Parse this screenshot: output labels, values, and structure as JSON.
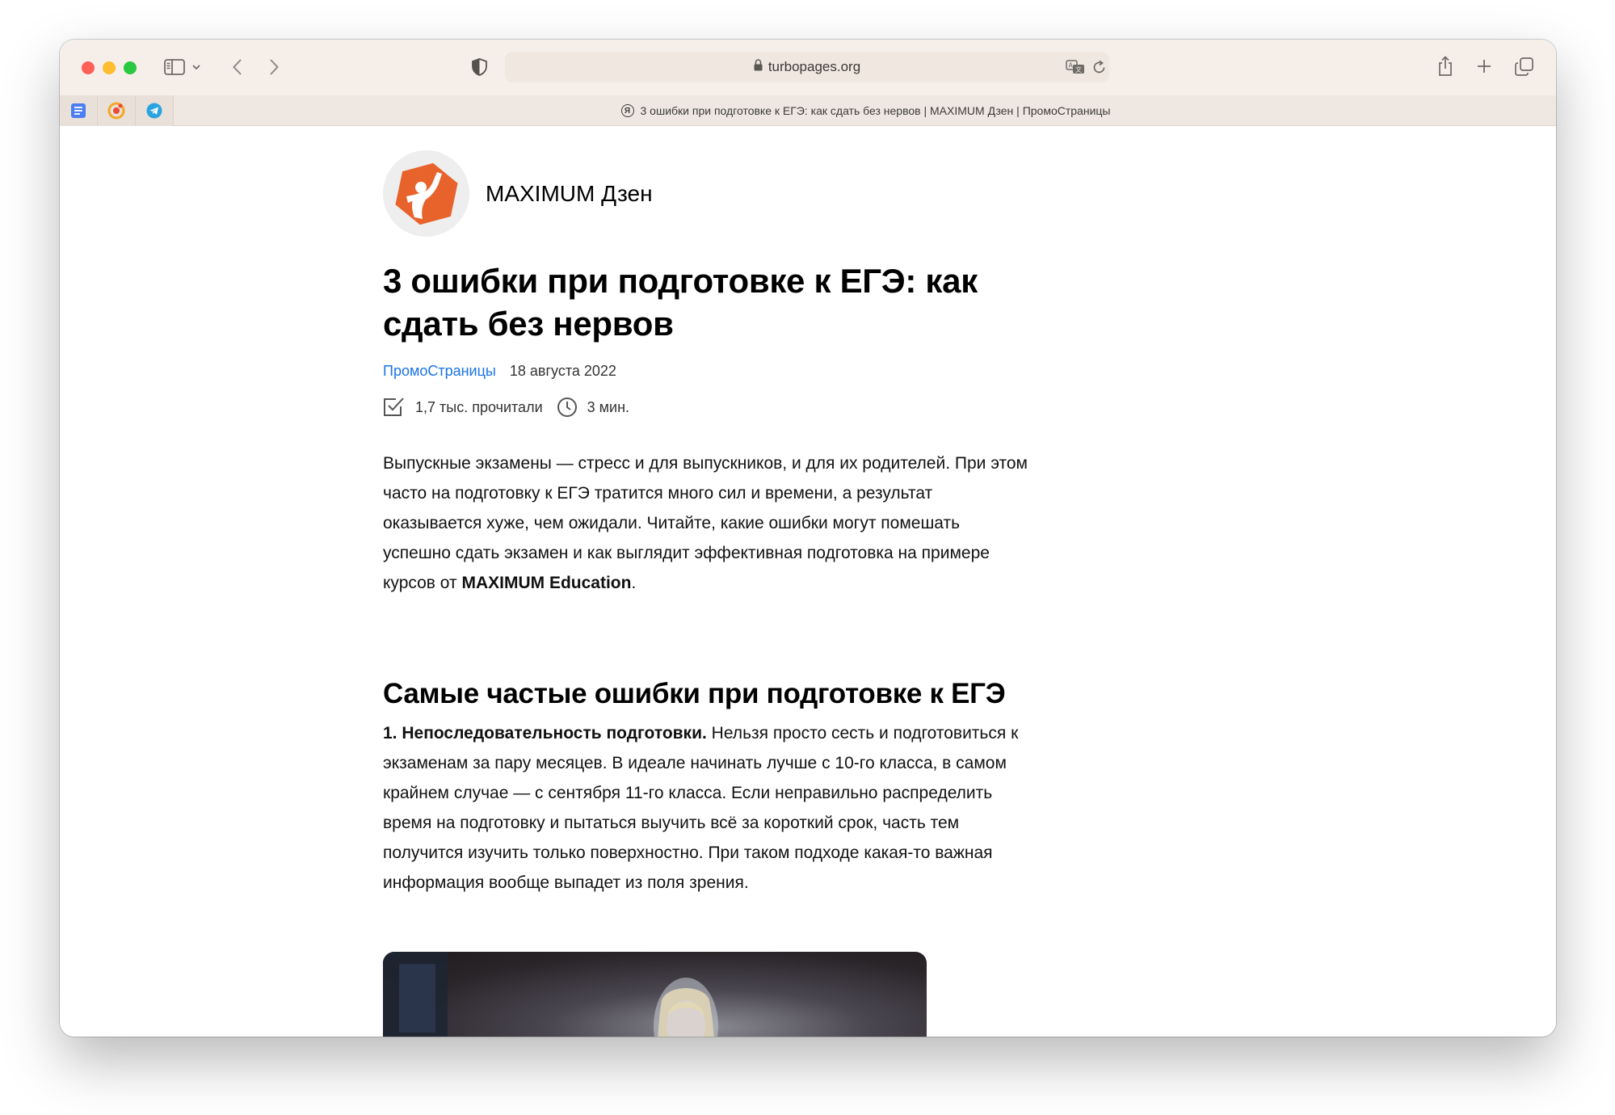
{
  "browser": {
    "url": "turbopages.org",
    "tab_title": "3 ошибки при подготовке к ЕГЭ: как сдать без нервов | MAXIMUM Дзен | ПромоСтраницы",
    "tab_icon_letter": "Я"
  },
  "article": {
    "channel_name": "MAXIMUM Дзен",
    "title": "3 ошибки при подготовке к ЕГЭ: как сдать без нервов",
    "source": "ПромоСтраницы",
    "date": "18 августа 2022",
    "reads": "1,7 тыс. прочитали",
    "read_time": "3 мин.",
    "intro_text": "Выпускные экзамены — стресс и для выпускников, и для их родителей. При этом часто на подготовку к ЕГЭ тратится много сил и времени, а результат оказывается хуже, чем ожидали. Читайте, какие ошибки могут помешать успешно сдать экзамен и как выглядит эффективная подготовка на примере курсов от ",
    "intro_bold": "MAXIMUM Education",
    "intro_end": ".",
    "section_heading": "Самые частые ошибки при подготовке к ЕГЭ",
    "point1_bold": "1. Непоследовательность подготовки.",
    "point1_text": " Нельзя просто сесть и подготовиться к экзаменам за пару месяцев. В идеале начинать лучше с 10-го класса, в самом крайнем случае — с сентября 11-го класса. Если неправильно распределить время на подготовку и пытаться выучить всё за короткий срок, часть тем получится изучить только поверхностно. При таком подходе какая-то важная информация вообще выпадет из поля зрения."
  },
  "colors": {
    "link": "#1a73e8",
    "logo_orange": "#e8632b",
    "titlebar": "#f6efe9"
  },
  "icons": [
    "sidebar-icon",
    "chevron-down-icon",
    "back-icon",
    "forward-icon",
    "shield-icon",
    "lock-icon",
    "translate-icon",
    "reload-icon",
    "share-icon",
    "plus-icon",
    "tabs-overview-icon",
    "checkbox-icon",
    "clock-icon"
  ]
}
